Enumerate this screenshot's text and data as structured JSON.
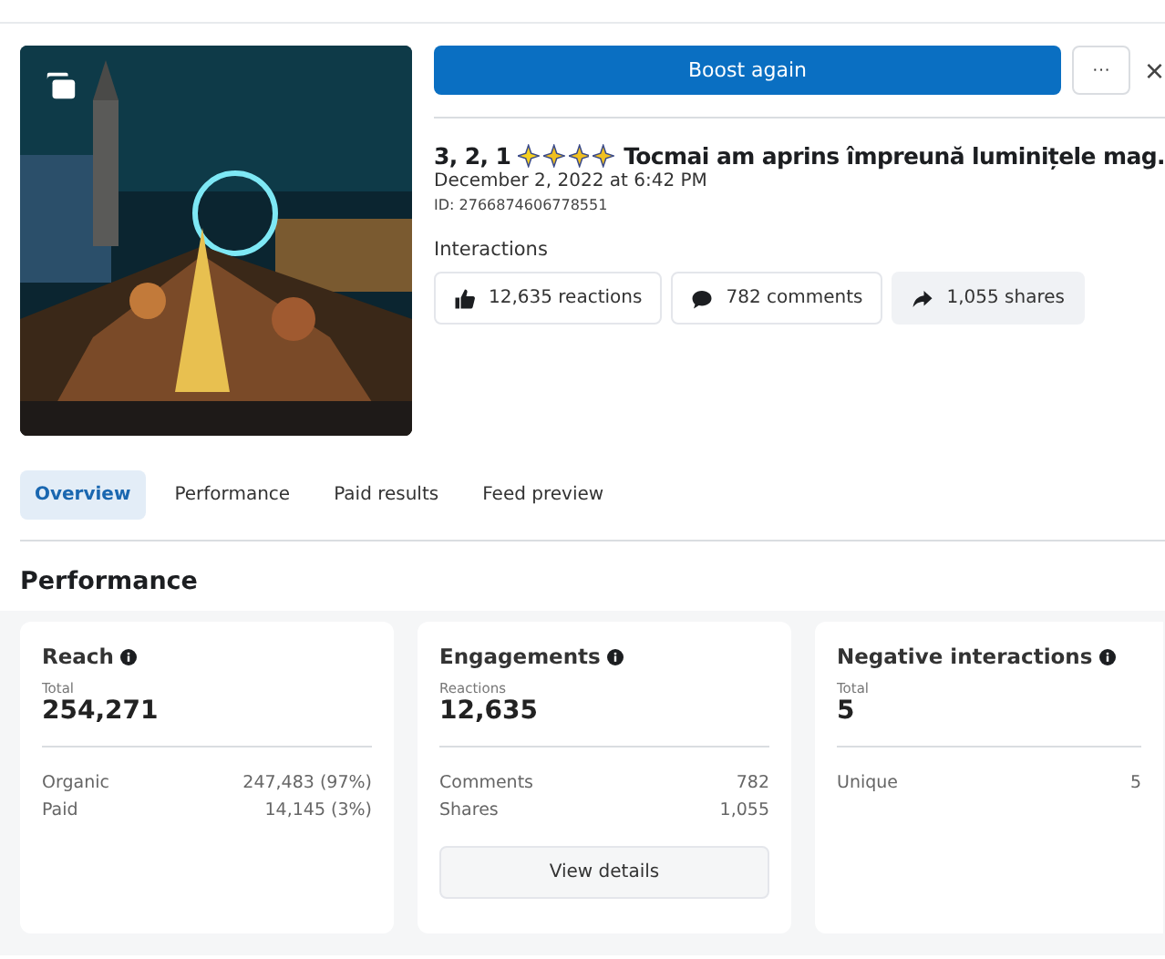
{
  "header": {
    "boost_button": "Boost again",
    "more_button": "···",
    "close_button": "×"
  },
  "post": {
    "title_prefix": "3, 2, 1",
    "title_text": "Tocmai am aprins împreună luminițele mag.",
    "date": "December 2, 2022 at 6:42 PM",
    "id": "ID: 2766874606778551"
  },
  "interactions": {
    "label": "Interactions",
    "chips": [
      {
        "kind": "reactions",
        "text": "12,635 reactions"
      },
      {
        "kind": "comments",
        "text": "782 comments"
      },
      {
        "kind": "shares",
        "text": "1,055 shares"
      }
    ]
  },
  "tabs": [
    {
      "label": "Overview",
      "selected": true
    },
    {
      "label": "Performance",
      "selected": false
    },
    {
      "label": "Paid results",
      "selected": false
    },
    {
      "label": "Feed preview",
      "selected": false
    }
  ],
  "section_title": "Performance",
  "cards": [
    {
      "title": "Reach",
      "total_label": "Total",
      "total": "254,271",
      "rows": [
        {
          "label": "Organic",
          "value": "247,483 (97%)"
        },
        {
          "label": "Paid",
          "value": "14,145 (3%)"
        }
      ]
    },
    {
      "title": "Engagements",
      "total_label": "Reactions",
      "total": "12,635",
      "rows": [
        {
          "label": "Comments",
          "value": "782"
        },
        {
          "label": "Shares",
          "value": "1,055"
        }
      ],
      "button": "View details"
    },
    {
      "title": "Negative interactions",
      "total_label": "Total",
      "total": "5",
      "rows": [
        {
          "label": "Unique",
          "value": "5"
        }
      ]
    }
  ]
}
